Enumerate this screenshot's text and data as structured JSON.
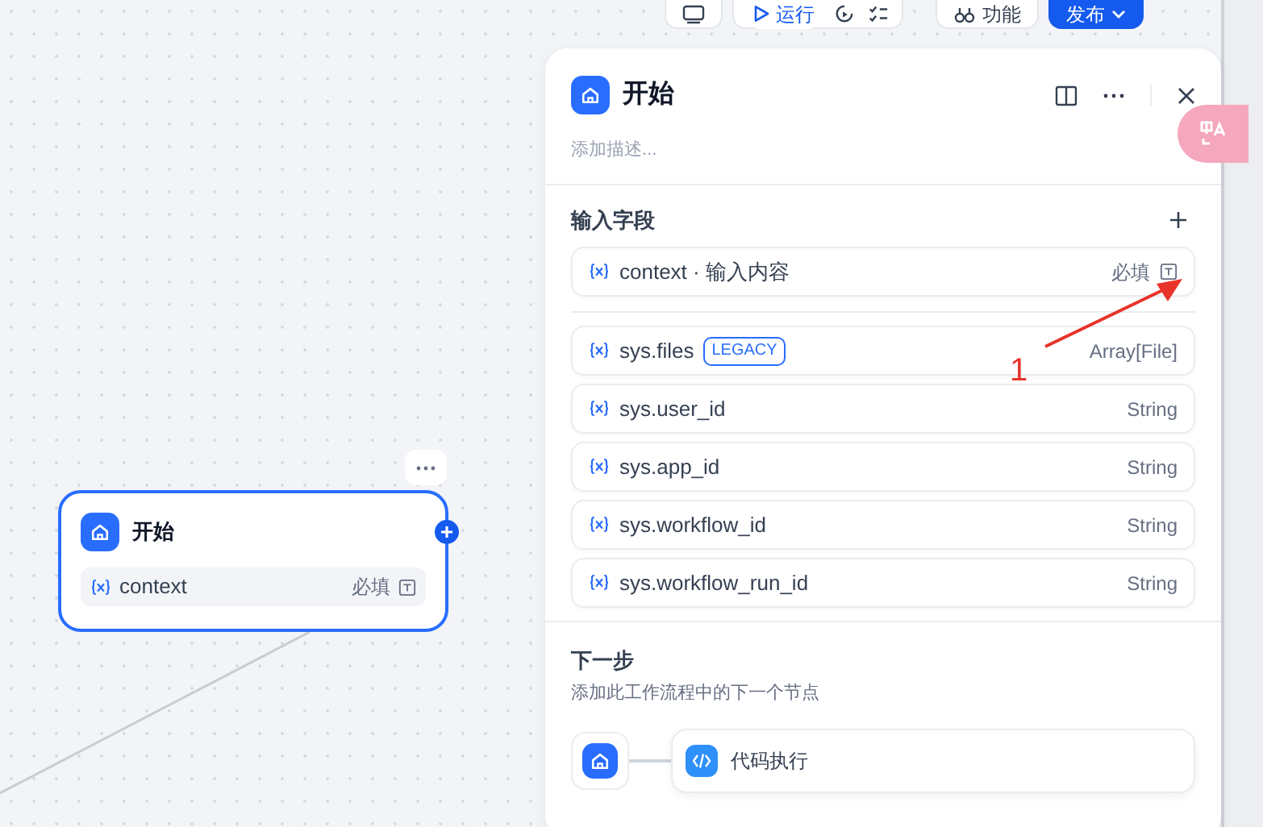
{
  "toolbar": {
    "run_label": "运行",
    "features_label": "功能",
    "publish_label": "发布"
  },
  "canvas_node": {
    "title": "开始",
    "variable": "context",
    "required": "必填"
  },
  "panel": {
    "title": "开始",
    "description_placeholder": "添加描述...",
    "input_section": {
      "title": "输入字段",
      "fields": [
        {
          "name": "context · 输入内容",
          "required": "必填"
        }
      ]
    },
    "system_variables": [
      {
        "name": "sys.files",
        "tag": "LEGACY",
        "type": "Array[File]"
      },
      {
        "name": "sys.user_id",
        "type": "String"
      },
      {
        "name": "sys.app_id",
        "type": "String"
      },
      {
        "name": "sys.workflow_id",
        "type": "String"
      },
      {
        "name": "sys.workflow_run_id",
        "type": "String"
      }
    ],
    "next_step": {
      "title": "下一步",
      "description": "添加此工作流程中的下一个节点",
      "next_node": "代码执行"
    }
  },
  "annotation": {
    "label": "1"
  }
}
